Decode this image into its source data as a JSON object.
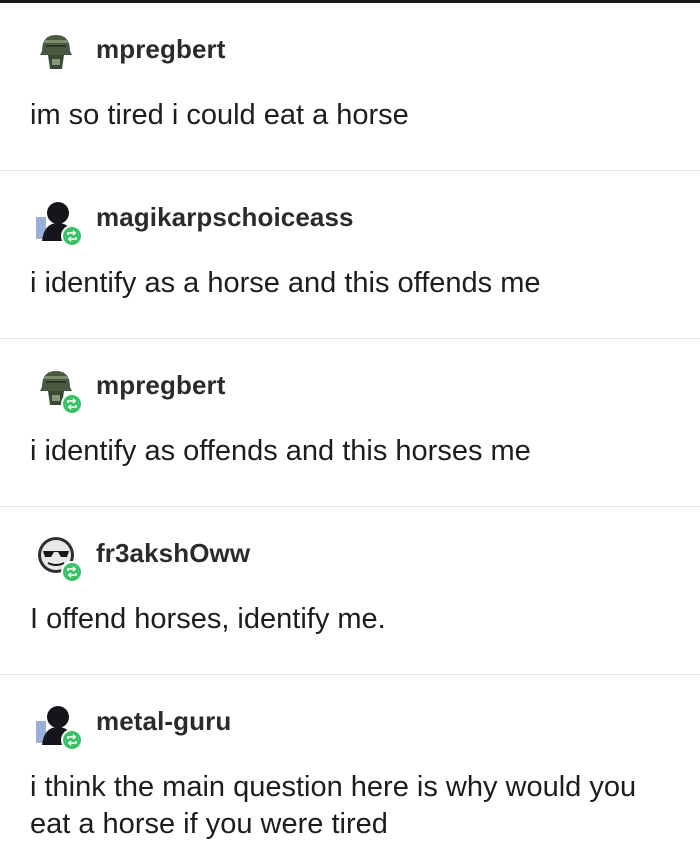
{
  "posts": [
    {
      "username": "mpregbert",
      "avatar": "helmet-avatar-icon",
      "reblog": false,
      "text": "im so tired i could eat a horse"
    },
    {
      "username": "magikarpschoiceass",
      "avatar": "silhouette-avatar-icon",
      "reblog": true,
      "text": "i identify as a horse and this offends me"
    },
    {
      "username": "mpregbert",
      "avatar": "helmet-avatar-icon",
      "reblog": true,
      "text": "i identify as offends and this horses me"
    },
    {
      "username": "fr3akshOww",
      "avatar": "sunglasses-avatar-icon",
      "reblog": true,
      "text": "I offend horses, identify me."
    },
    {
      "username": "metal-guru",
      "avatar": "silhouette-avatar-icon",
      "reblog": true,
      "text": "i think the main question here is why would you eat a horse if you were tired"
    }
  ],
  "colors": {
    "reblog_badge": "#39c46a",
    "divider": "#e6e6e6",
    "text": "#1d1d1d"
  }
}
